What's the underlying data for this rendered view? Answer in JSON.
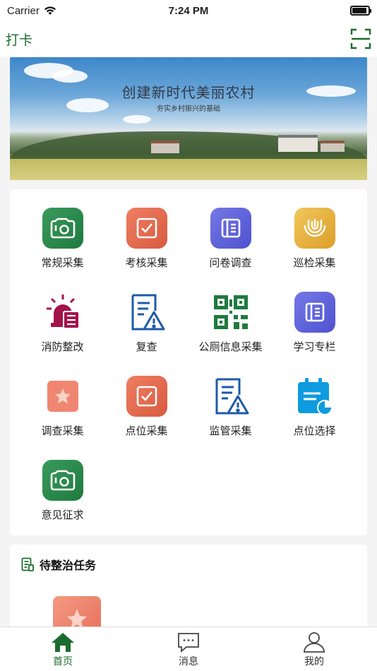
{
  "status_bar": {
    "carrier": "Carrier",
    "time": "7:24 PM"
  },
  "nav": {
    "title": "打卡",
    "scan_icon": "scan-icon"
  },
  "banner": {
    "title": "创建新时代美丽农村",
    "subtitle": "夯实乡村振兴的基础"
  },
  "grid": {
    "items": [
      {
        "label": "常规采集",
        "icon": "camera-icon"
      },
      {
        "label": "考核采集",
        "icon": "checkbox-icon"
      },
      {
        "label": "问卷调查",
        "icon": "document-icon"
      },
      {
        "label": "巡检采集",
        "icon": "fingerprint-icon"
      },
      {
        "label": "消防整改",
        "icon": "alarm-light-icon"
      },
      {
        "label": "复查",
        "icon": "report-warning-icon"
      },
      {
        "label": "公厕信息采集",
        "icon": "qr-code-icon"
      },
      {
        "label": "学习专栏",
        "icon": "document-icon"
      },
      {
        "label": "调查采集",
        "icon": "star-icon"
      },
      {
        "label": "点位采集",
        "icon": "checkbox-icon"
      },
      {
        "label": "监管采集",
        "icon": "report-warning-icon"
      },
      {
        "label": "点位选择",
        "icon": "calendar-chart-icon"
      },
      {
        "label": "意见征求",
        "icon": "camera-icon"
      }
    ]
  },
  "tasks": {
    "title": "待整治任务"
  },
  "tab_bar": {
    "tabs": [
      {
        "label": "首页",
        "icon": "home-icon",
        "active": true
      },
      {
        "label": "消息",
        "icon": "message-icon",
        "active": false
      },
      {
        "label": "我的",
        "icon": "user-icon",
        "active": false
      }
    ]
  },
  "colors": {
    "brand_green": "#1b6b2e",
    "accent_red": "#a3124a",
    "accent_blue": "#1e5aa8"
  }
}
